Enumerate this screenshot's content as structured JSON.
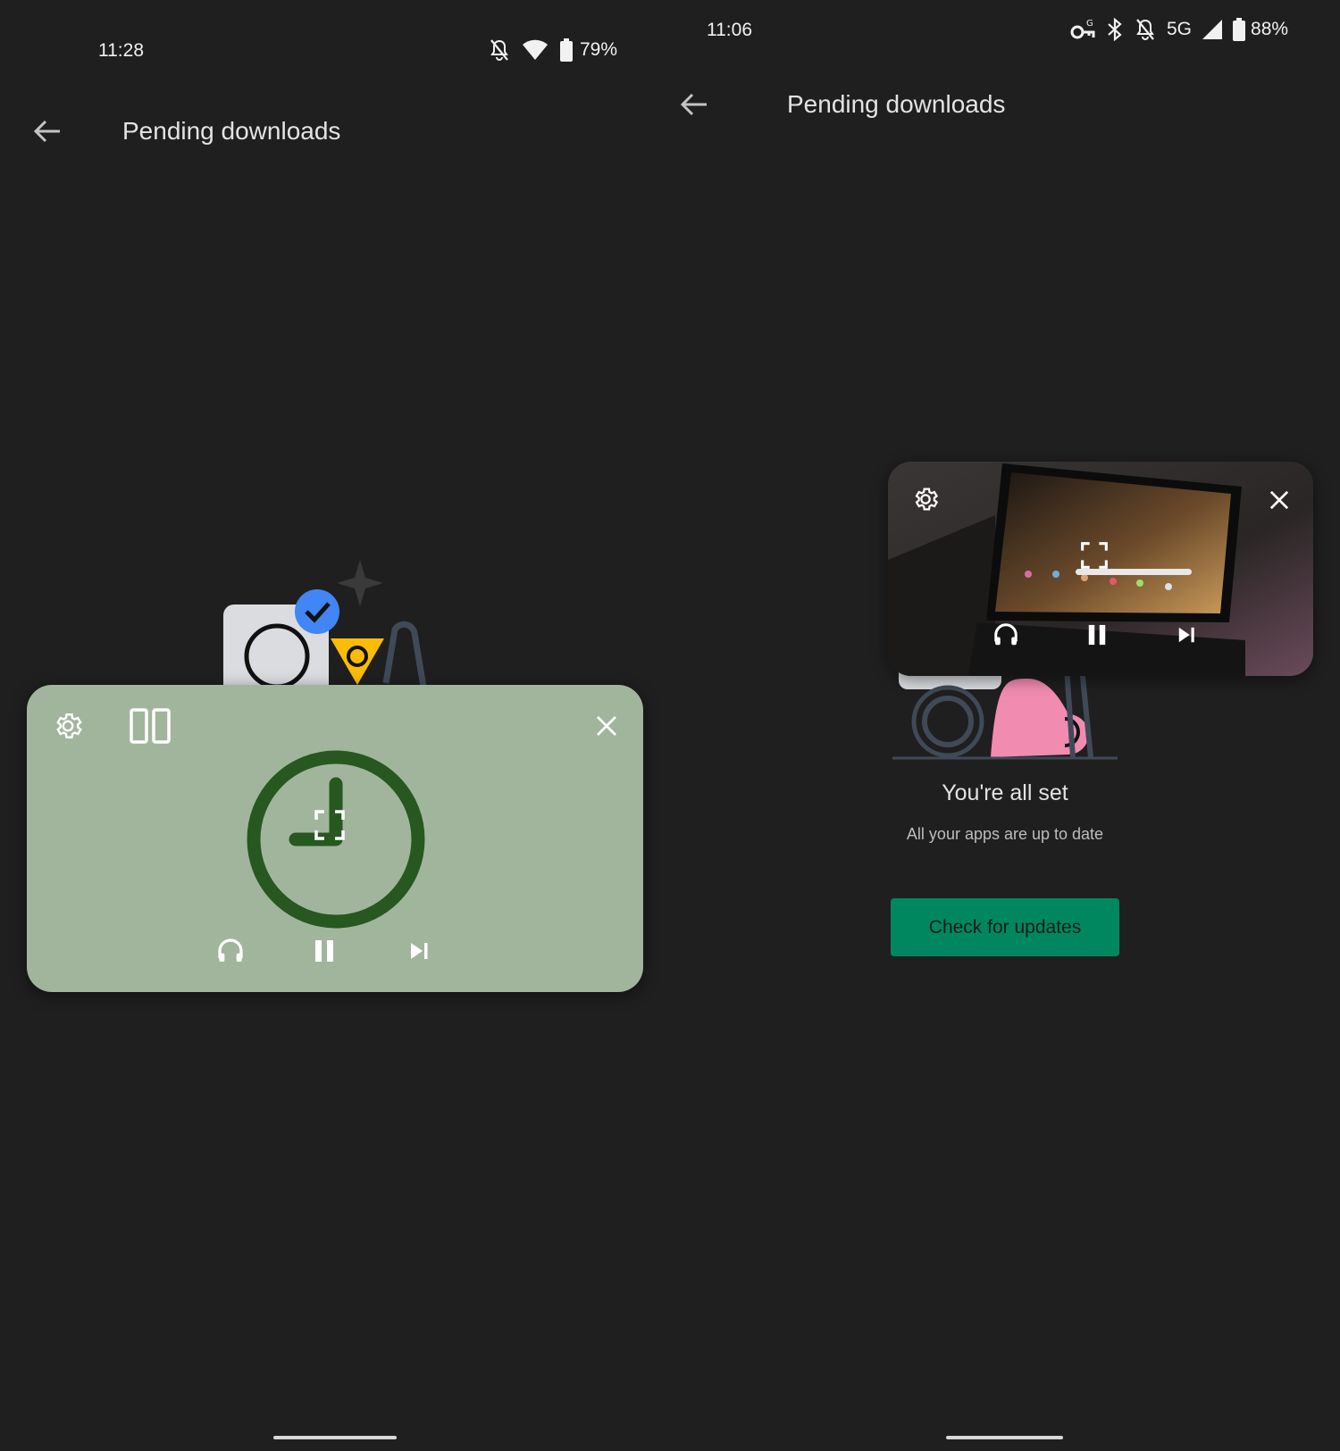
{
  "left_screen": {
    "status_bar": {
      "time": "11:28",
      "battery_percent": "79%",
      "icons": [
        "bell-off-icon",
        "wifi-icon",
        "battery-icon"
      ]
    },
    "app_bar": {
      "back_icon": "arrow-back-icon",
      "title": "Pending downloads"
    },
    "pip_player": {
      "background_color": "#a1b59d",
      "content": "clock-icon",
      "controls": [
        "settings-icon",
        "split-screen-icon",
        "close-icon",
        "fullscreen-icon",
        "headphones-icon",
        "pause-icon",
        "skip-next-icon"
      ]
    }
  },
  "right_screen": {
    "status_bar": {
      "time": "11:06",
      "network": "5G",
      "battery_percent": "88%",
      "icons": [
        "vpn-key-icon",
        "bluetooth-icon",
        "bell-off-icon",
        "signal-icon",
        "battery-icon"
      ]
    },
    "app_bar": {
      "back_icon": "arrow-back-icon",
      "title": "Pending downloads"
    },
    "pip_player": {
      "content": "tablet-video-thumbnail",
      "controls": [
        "settings-icon",
        "close-icon",
        "fullscreen-icon",
        "headphones-icon",
        "pause-icon",
        "skip-next-icon"
      ]
    },
    "empty_state": {
      "title": "You're all set",
      "subtitle": "All your apps are up to date",
      "button_label": "Check for updates",
      "button_color": "#01875f"
    }
  }
}
